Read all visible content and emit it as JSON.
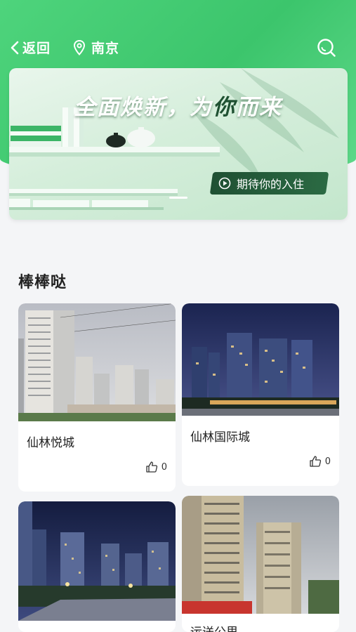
{
  "header": {
    "back_label": "返回",
    "city": "南京"
  },
  "banner": {
    "title_part1": "全面焕新，为",
    "title_highlight": "你",
    "title_part2": "而来",
    "button_label": "期待你的入住"
  },
  "section": {
    "title": "棒棒哒"
  },
  "cards": [
    {
      "name": "仙林悦城",
      "likes": "0"
    },
    {
      "name": "仙林国际城",
      "likes": "0"
    },
    {
      "name": "",
      "likes": ""
    },
    {
      "name": "运送公里",
      "likes": ""
    }
  ],
  "colors": {
    "header_green": "#3cc56c",
    "banner_button": "#1f5033"
  }
}
